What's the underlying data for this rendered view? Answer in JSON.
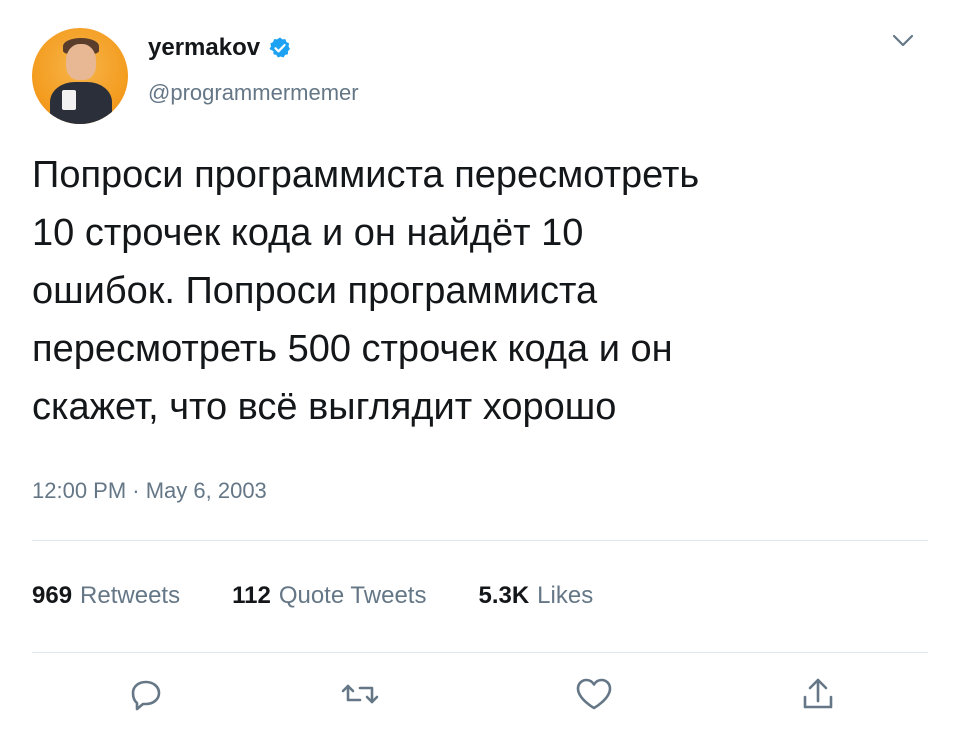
{
  "user": {
    "display_name": "yermakov",
    "handle": "@programmermemer",
    "verified_icon": "verified-badge-icon",
    "verified_color": "#1da1f2"
  },
  "tweet": {
    "text": "Попроси программиста пересмотреть\n10 строчек кода и он найдёт 10\nошибок. Попроси программиста\nпересмотреть 500 строчек кода и он\nскажет, что всё выглядит хорошо",
    "timestamp": "12:00 PM · May 6, 2003"
  },
  "stats": [
    {
      "count": "969",
      "label": "Retweets"
    },
    {
      "count": "112",
      "label": "Quote Tweets"
    },
    {
      "count": "5.3K",
      "label": "Likes"
    }
  ],
  "actions": [
    "reply-icon",
    "retweet-icon",
    "like-icon",
    "share-icon"
  ],
  "colors": {
    "text": "#14171a",
    "secondary": "#657786",
    "divider": "#e1e8ed",
    "icon": "#657786"
  }
}
